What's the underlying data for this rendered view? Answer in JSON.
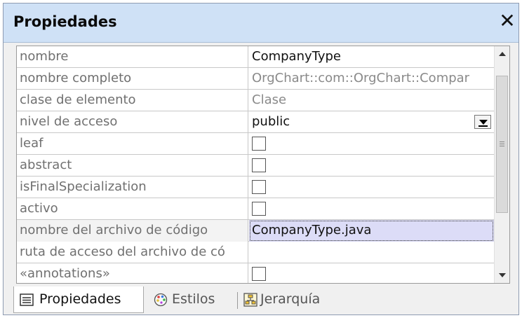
{
  "window": {
    "title": "Propiedades",
    "close_glyph": "✕"
  },
  "rows": [
    {
      "name": "nombre",
      "value": "CompanyType",
      "kind": "text",
      "emphasis": true
    },
    {
      "name": "nombre completo",
      "value": "OrgChart::com::OrgChart::Compar",
      "kind": "text",
      "emphasis": false
    },
    {
      "name": "clase de elemento",
      "value": "Clase",
      "kind": "text",
      "emphasis": false
    },
    {
      "name": "nivel de acceso",
      "value": "public",
      "kind": "dropdown",
      "emphasis": true
    },
    {
      "name": "leaf",
      "value": "",
      "kind": "checkbox",
      "checked": false
    },
    {
      "name": "abstract",
      "value": "",
      "kind": "checkbox",
      "checked": false
    },
    {
      "name": "isFinalSpecialization",
      "value": "",
      "kind": "checkbox",
      "checked": false
    },
    {
      "name": "activo",
      "value": "",
      "kind": "checkbox",
      "checked": false
    },
    {
      "name": "nombre del archivo de código",
      "value": "CompanyType.java",
      "kind": "text",
      "emphasis": true,
      "selected": true
    },
    {
      "name": "ruta de acceso del archivo de có",
      "value": "",
      "kind": "text",
      "emphasis": false
    },
    {
      "name": "«annotations»",
      "value": "",
      "kind": "checkbox",
      "checked": false
    }
  ],
  "tabs": [
    {
      "label": "Propiedades",
      "icon": "list-icon",
      "active": true
    },
    {
      "label": "Estilos",
      "icon": "palette-icon",
      "active": false
    },
    {
      "label": "Jerarquía",
      "icon": "hierarchy-icon",
      "active": false
    }
  ],
  "colors": {
    "title_bg": "#cfe1f6",
    "selected_bg": "#dcdcf7",
    "frame": "#8e9bb1"
  }
}
